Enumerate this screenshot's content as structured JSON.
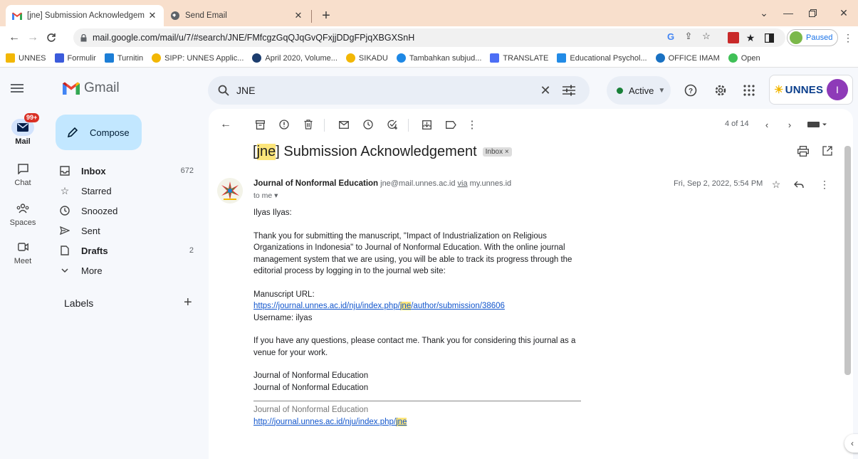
{
  "browser": {
    "tabs": [
      {
        "title": "[jne] Submission Acknowledgem"
      },
      {
        "title": "Send Email"
      }
    ],
    "url": "mail.google.com/mail/u/7/#search/JNE/FMfcgzGqQJqGvQFxjjDDgFPjqXBGXSnH",
    "profile_status": "Paused",
    "bookmarks": [
      {
        "label": "UNNES",
        "color": "#f2b705"
      },
      {
        "label": "Formulir",
        "color": "#3b5bdb"
      },
      {
        "label": "Turnitin",
        "color": "#1c7ed6"
      },
      {
        "label": "SIPP: UNNES Applic...",
        "color": "#f2b705"
      },
      {
        "label": "April 2020, Volume...",
        "color": "#1c3d6e"
      },
      {
        "label": "SIKADU",
        "color": "#f2b705"
      },
      {
        "label": "Tambahkan subjud...",
        "color": "#2b8a3e"
      },
      {
        "label": "TRANSLATE",
        "color": "#4c6ef5"
      },
      {
        "label": "Educational Psychol...",
        "color": "#228be6"
      },
      {
        "label": "OFFICE IMAM",
        "color": "#1971c2"
      },
      {
        "label": "Open",
        "color": "#40c057"
      }
    ]
  },
  "gmail": {
    "app_name": "Gmail",
    "search_value": "JNE",
    "status": "Active",
    "account_logo": "UNNES",
    "avatar_initial": "I",
    "rail": [
      {
        "label": "Mail",
        "badge": "99+"
      },
      {
        "label": "Chat"
      },
      {
        "label": "Spaces"
      },
      {
        "label": "Meet"
      }
    ],
    "compose_label": "Compose",
    "nav": [
      {
        "label": "Inbox",
        "count": "672"
      },
      {
        "label": "Starred",
        "count": ""
      },
      {
        "label": "Snoozed",
        "count": ""
      },
      {
        "label": "Sent",
        "count": ""
      },
      {
        "label": "Drafts",
        "count": "2"
      },
      {
        "label": "More",
        "count": ""
      }
    ],
    "labels_heading": "Labels",
    "pager": "4 of 14",
    "message": {
      "subject_prefix": "[",
      "subject_tag": "jne",
      "subject_rest": "] Submission Acknowledgement",
      "label_chip": "Inbox ×",
      "sender_name": "Journal of Nonformal Education",
      "sender_email": "jne@mail.unnes.ac.id",
      "via_label": "via",
      "via_domain": "my.unnes.id",
      "recipient": "to me ▾",
      "date": "Fri, Sep 2, 2022, 5:54 PM",
      "greeting": "Ilyas Ilyas:",
      "para1": "Thank you for submitting the manuscript, \"Impact of Industrialization on Religious Organizations in Indonesia\" to Journal of Nonformal Education. With the online journal management system that we are using, you will be able to track its progress through the editorial process by logging in to the journal web site:",
      "manuscript_label": "Manuscript URL:",
      "manuscript_url_a": "https://journal.unnes.ac.id/nju/index.php/",
      "manuscript_url_hl": "jne",
      "manuscript_url_b": "/author/submission/38606",
      "username_line": "Username: ilyas",
      "para2": "If you have any questions, please contact me. Thank you for considering this journal as a venue for your work.",
      "sig1": "Journal of Nonformal Education",
      "sig2": "Journal of Nonformal Education",
      "footer_name": "Journal of Nonformal Education",
      "footer_url_a": "http://journal.unnes.ac.id/nju/index.php/",
      "footer_url_hl": "jne"
    }
  }
}
